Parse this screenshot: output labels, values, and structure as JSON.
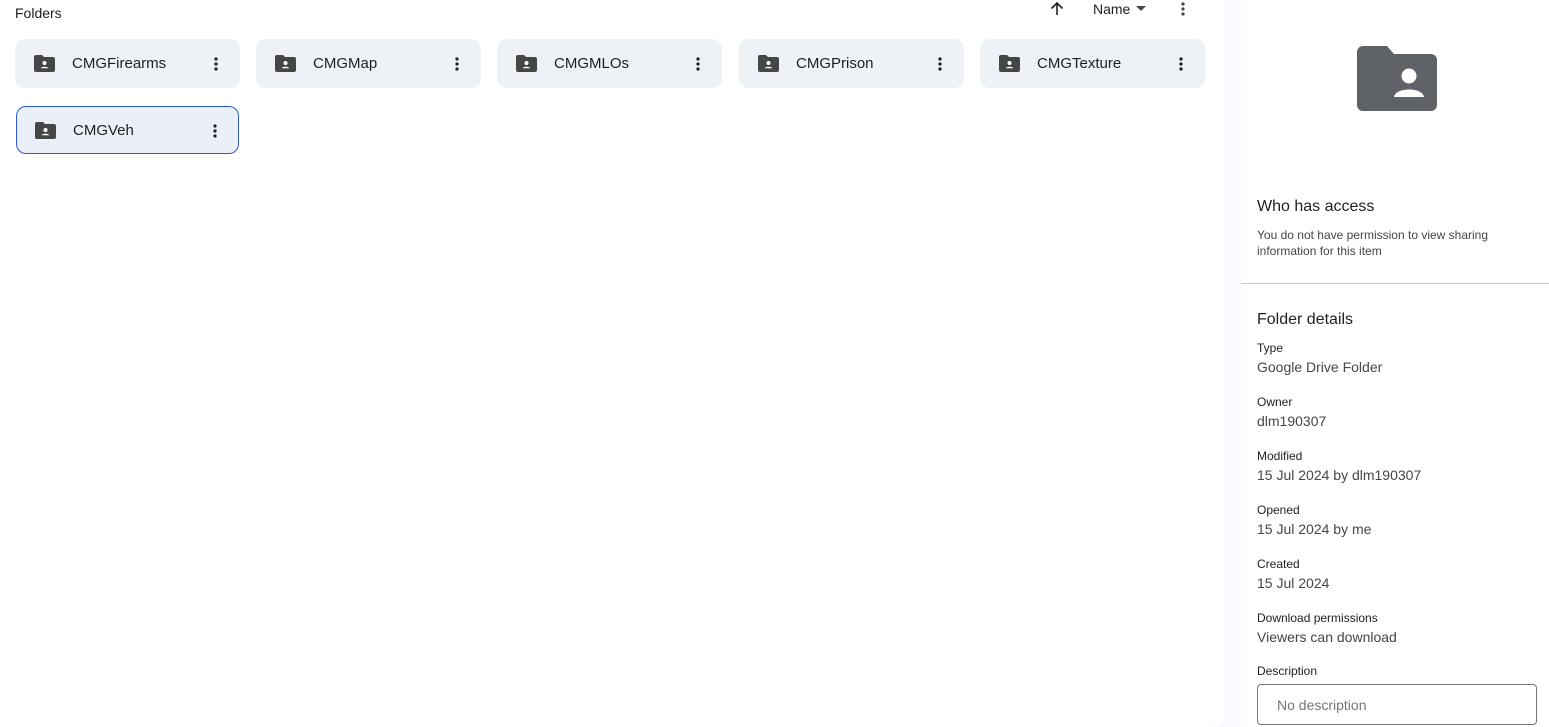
{
  "main": {
    "section_title": "Folders",
    "sort": {
      "field_label": "Name",
      "direction_icon": "arrow-up-icon",
      "dropdown_icon": "caret-down-icon",
      "more_icon": "more-vert-icon"
    },
    "folders": [
      {
        "name": "CMGFirearms",
        "icon": "shared-folder-icon",
        "selected": false
      },
      {
        "name": "CMGMap",
        "icon": "shared-folder-icon",
        "selected": false
      },
      {
        "name": "CMGMLOs",
        "icon": "shared-folder-icon",
        "selected": false
      },
      {
        "name": "CMGPrison",
        "icon": "shared-folder-icon",
        "selected": false
      },
      {
        "name": "CMGTexture",
        "icon": "shared-folder-icon",
        "selected": false
      },
      {
        "name": "CMGVeh",
        "icon": "shared-folder-icon",
        "selected": true
      }
    ]
  },
  "details": {
    "preview_icon": "shared-folder-icon",
    "access": {
      "title": "Who has access",
      "text": "You do not have permission to view sharing information for this item"
    },
    "folder_details_title": "Folder details",
    "properties": [
      {
        "label": "Type",
        "value": "Google Drive Folder"
      },
      {
        "label": "Owner",
        "value": "dlm190307"
      },
      {
        "label": "Modified",
        "value": "15 Jul 2024 by dlm190307"
      },
      {
        "label": "Opened",
        "value": "15 Jul 2024 by me"
      },
      {
        "label": "Created",
        "value": "15 Jul 2024"
      },
      {
        "label": "Download permissions",
        "value": "Viewers can download"
      }
    ],
    "description": {
      "label": "Description",
      "placeholder": "No description"
    }
  },
  "colors": {
    "card_background": "#eef1f6",
    "selected_border": "#2d5ac9",
    "icon_dark": "#444746",
    "preview_icon": "#5f6368"
  }
}
